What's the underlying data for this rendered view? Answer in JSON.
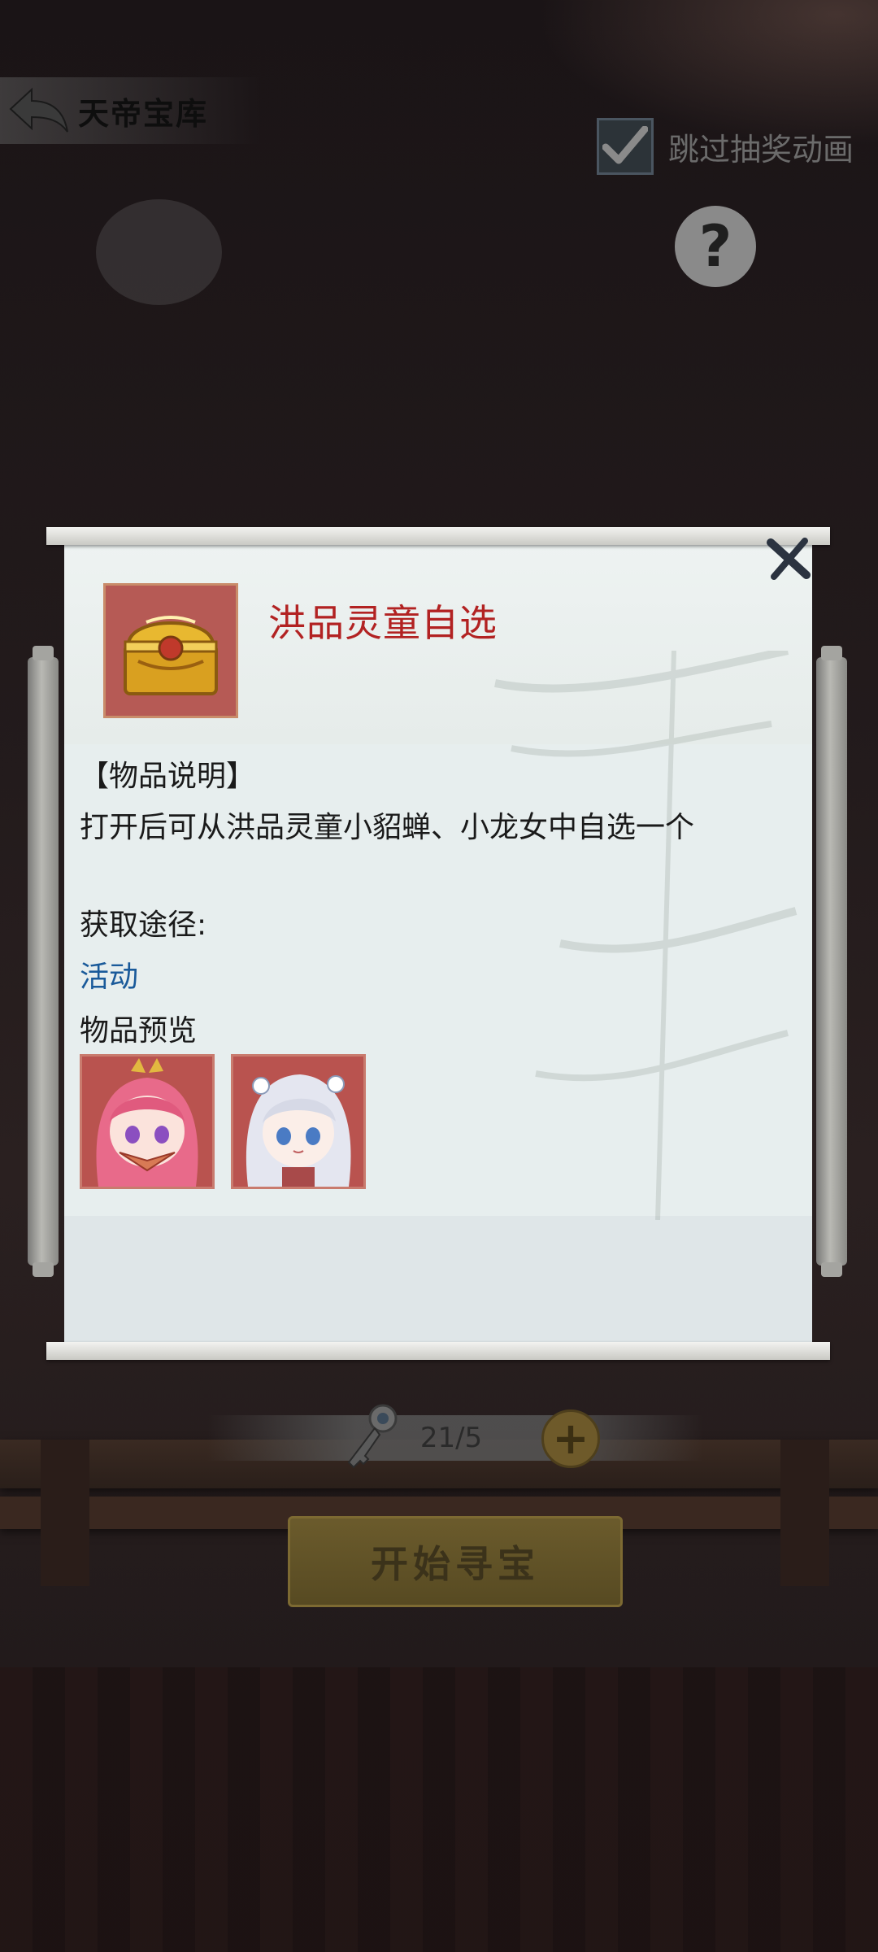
{
  "header": {
    "back_icon": "back-arrow-icon",
    "title": "天帝宝库",
    "skip_animation_label": "跳过抽奖动画",
    "skip_animation_checked": true,
    "help_icon": "question-mark-icon",
    "help_symbol": "?"
  },
  "bottom": {
    "key_icon": "key-icon",
    "counter": "21/5",
    "add_symbol": "+",
    "start_label": "开始寻宝"
  },
  "modal": {
    "close_icon": "close-x-icon",
    "item_icon": "treasure-chest-icon",
    "item_name": "洪品灵童自选",
    "description_header": "【物品说明】",
    "description": "打开后可从洪品灵童小貂蝉、小龙女中自选一个",
    "source_header": "获取途径:",
    "source_link": "活动",
    "preview_header": "物品预览",
    "preview_items": [
      {
        "icon": "pink-hair-girl-portrait"
      },
      {
        "icon": "silver-hair-girl-portrait"
      }
    ]
  },
  "colors": {
    "item_name": "#b22222",
    "link": "#1a5a9a",
    "panel": "#dfe6e8",
    "icon_frame": "#b65a55"
  }
}
